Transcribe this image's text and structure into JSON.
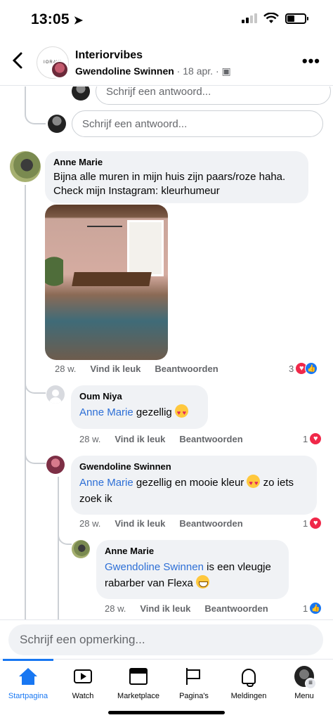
{
  "status_bar": {
    "time": "13:05"
  },
  "header": {
    "title": "Interiorvibes",
    "author": "Gwendoline Swinnen",
    "meta": " · 18 apr. · ",
    "avatar_text": "IORAVI"
  },
  "thread": {
    "top_reply_placeholder": "Schrijf een antwoord...",
    "reply_placeholder": "Schrijf een antwoord...",
    "comments": [
      {
        "author": "Anne Marie",
        "text_line1": "Bijna alle muren in mijn huis zijn paars/roze haha.",
        "text_line2": "Check mijn Instagram: kleurhumeur",
        "age": "28 w.",
        "like": "Vind ik leuk",
        "reply": "Beantwoorden",
        "reactions": "3"
      },
      {
        "author": "Oum Niya",
        "mention": "Anne Marie",
        "text": " gezellig ",
        "age": "28 w.",
        "like": "Vind ik leuk",
        "reply": "Beantwoorden",
        "reactions": "1"
      },
      {
        "author": "Gwendoline Swinnen",
        "mention": "Anne Marie",
        "text_a": " gezellig en mooie kleur ",
        "text_b": " zo iets",
        "text_line2": "zoek ik",
        "age": "28 w.",
        "like": "Vind ik leuk",
        "reply": "Beantwoorden",
        "reactions": "1"
      },
      {
        "author": "Anne Marie",
        "mention": "Gwendoline Swinnen",
        "text_a": " is een vleugje",
        "text_line2": "rabarber van Flexa ",
        "age": "28 w.",
        "like": "Vind ik leuk",
        "reply": "Beantwoorden",
        "reactions": "1"
      }
    ]
  },
  "composer": {
    "placeholder": "Schrijf een opmerking..."
  },
  "nav": [
    {
      "label": "Startpagina",
      "icon": "home-icon",
      "active": true
    },
    {
      "label": "Watch",
      "icon": "watch-icon"
    },
    {
      "label": "Marketplace",
      "icon": "marketplace-icon"
    },
    {
      "label": "Pagina's",
      "icon": "flag-icon"
    },
    {
      "label": "Meldingen",
      "icon": "bell-icon"
    },
    {
      "label": "Menu",
      "icon": "menu-avatar-icon"
    }
  ],
  "colors": {
    "accent": "#1877f2",
    "mention": "#2d6fd6",
    "heart": "#f02849",
    "bubble": "#f0f2f5"
  }
}
